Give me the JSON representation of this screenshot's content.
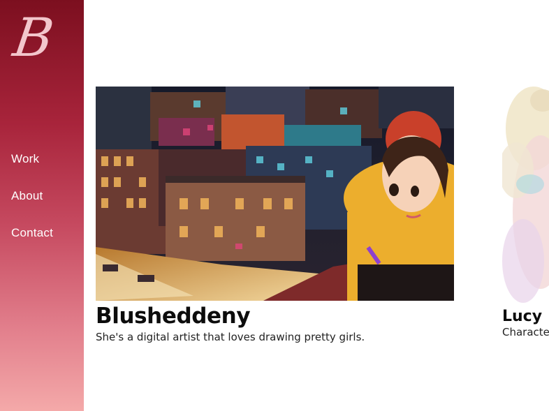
{
  "brand": {
    "logo_letter": "B",
    "accent": "#a8243b"
  },
  "nav": {
    "items": [
      {
        "label": "Work"
      },
      {
        "label": "About"
      },
      {
        "label": "Contact"
      }
    ]
  },
  "cards": [
    {
      "title": "Blusheddeny",
      "description": "She's a digital artist that loves drawing pretty girls.",
      "image_icon": "city-night-illustration"
    },
    {
      "title": "Lucy",
      "description": "Characte",
      "image_icon": "watercolor-illustration"
    }
  ]
}
